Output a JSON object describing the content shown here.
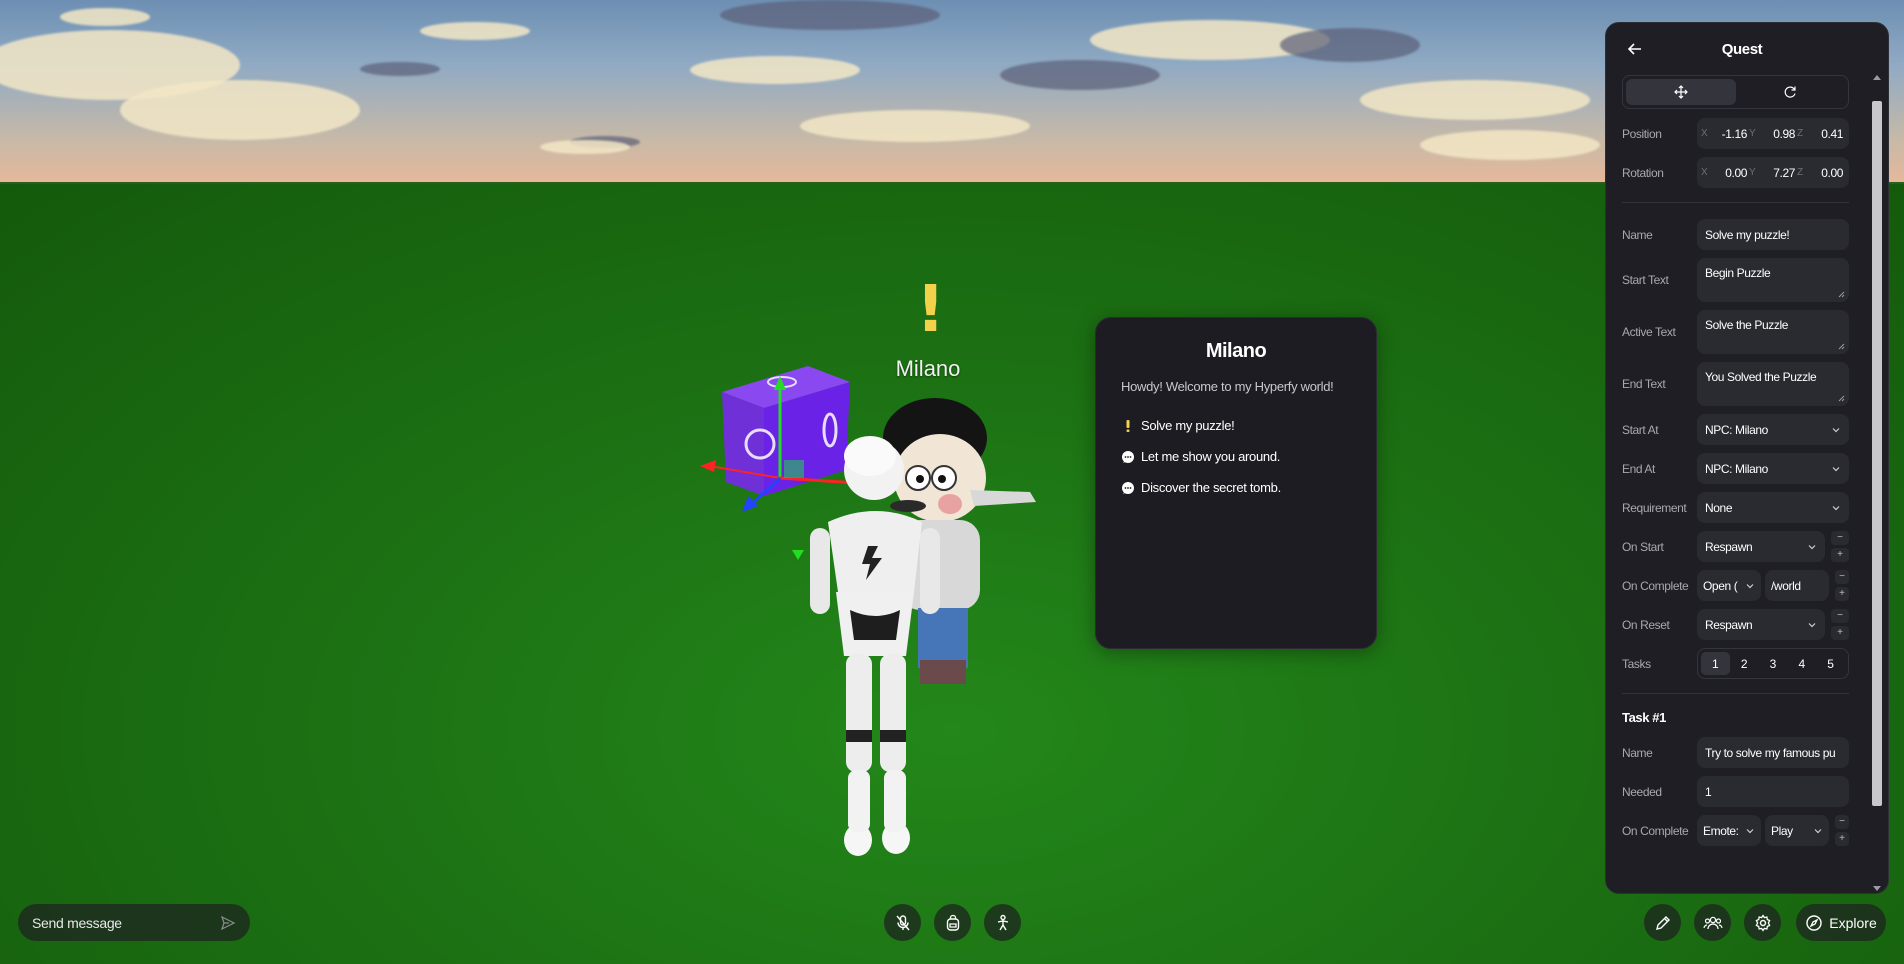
{
  "scene": {
    "npc_name": "Milano",
    "npc_marker": "!"
  },
  "dialog": {
    "title": "Milano",
    "greeting": "Howdy! Welcome to my Hyperfy world!",
    "options": [
      {
        "icon": "exclamation-icon",
        "label": "Solve my puzzle!"
      },
      {
        "icon": "chat-bubble-icon",
        "label": "Let me show you around."
      },
      {
        "icon": "chat-bubble-icon",
        "label": "Discover the secret tomb."
      }
    ]
  },
  "panel": {
    "title": "Quest",
    "position": {
      "label": "Position",
      "x": "-1.16",
      "y": "0.98",
      "z": "0.41"
    },
    "rotation": {
      "label": "Rotation",
      "x": "0.00",
      "y": "7.27",
      "z": "0.00"
    },
    "axes": {
      "x": "X",
      "y": "Y",
      "z": "Z"
    },
    "name": {
      "label": "Name",
      "value": "Solve my puzzle!"
    },
    "start_text": {
      "label": "Start Text",
      "value": "Begin Puzzle"
    },
    "active_text": {
      "label": "Active Text",
      "value": "Solve the Puzzle"
    },
    "end_text": {
      "label": "End Text",
      "value": "You Solved the Puzzle"
    },
    "start_at": {
      "label": "Start At",
      "value": "NPC: Milano"
    },
    "end_at": {
      "label": "End At",
      "value": "NPC: Milano"
    },
    "requirement": {
      "label": "Requirement",
      "value": "None"
    },
    "on_start": {
      "label": "On Start",
      "value": "Respawn"
    },
    "on_complete": {
      "label": "On Complete",
      "value": "Open (",
      "input": "/world"
    },
    "on_reset": {
      "label": "On Reset",
      "value": "Respawn"
    },
    "tasks": {
      "label": "Tasks",
      "tabs": [
        "1",
        "2",
        "3",
        "4",
        "5"
      ],
      "active": "1"
    },
    "task": {
      "title": "Task #1",
      "name": {
        "label": "Name",
        "value": "Try to solve my famous pu"
      },
      "needed": {
        "label": "Needed",
        "value": "1"
      },
      "on_complete": {
        "label": "On Complete",
        "value": "Emote:",
        "value2": "Play"
      }
    },
    "pm": {
      "minus": "−",
      "plus": "+"
    }
  },
  "bottom": {
    "chat_placeholder": "Send message",
    "explore_label": "Explore"
  },
  "colors": {
    "panel_bg": "#1e1e24",
    "field_bg": "#2a2a31",
    "marker": "#f2d24a",
    "grass": "#1d7414"
  }
}
